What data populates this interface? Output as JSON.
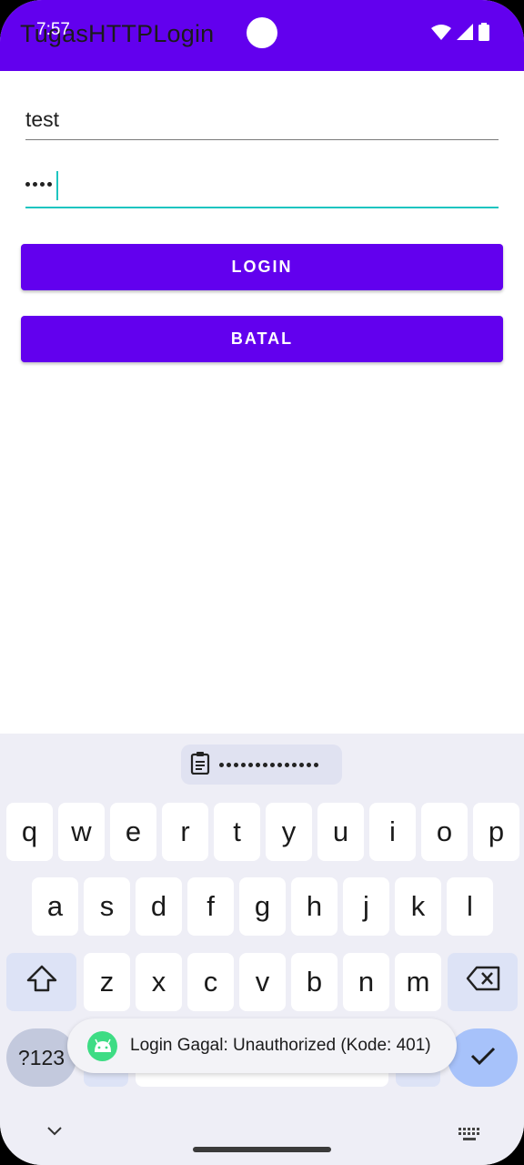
{
  "status_bar": {
    "time": "7:57"
  },
  "app_bar": {
    "title": "TugasHTTPLogin",
    "color": "#6200ee"
  },
  "form": {
    "username_value": "test",
    "password_mask_count": 4,
    "login_label": "LOGIN",
    "cancel_label": "BATAL"
  },
  "keyboard": {
    "clipboard_icon": "clipboard-icon",
    "row1": [
      "q",
      "w",
      "e",
      "r",
      "t",
      "y",
      "u",
      "i",
      "o",
      "p"
    ],
    "row2": [
      "a",
      "s",
      "d",
      "f",
      "g",
      "h",
      "j",
      "k",
      "l"
    ],
    "row3": [
      "z",
      "x",
      "c",
      "v",
      "b",
      "n",
      "m"
    ],
    "symbols_label": "?123",
    "shift_icon": "shift-icon",
    "backspace_icon": "backspace-icon",
    "enter_icon": "checkmark-icon"
  },
  "toast": {
    "message": "Login Gagal: Unauthorized (Kode: 401)",
    "icon": "android-icon"
  },
  "nav": {
    "left_icon": "chevron-down-icon",
    "right_icon": "keyboard-icon"
  }
}
